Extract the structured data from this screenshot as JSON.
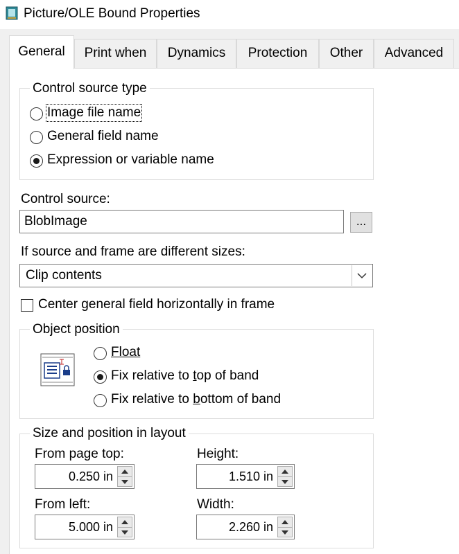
{
  "window": {
    "title": "Picture/OLE Bound Properties"
  },
  "tabs": [
    {
      "label": "General"
    },
    {
      "label": "Print when"
    },
    {
      "label": "Dynamics"
    },
    {
      "label": "Protection"
    },
    {
      "label": "Other"
    },
    {
      "label": "Advanced"
    }
  ],
  "active_tab": "General",
  "control_source_type": {
    "title": "Control source type",
    "options": [
      {
        "label": "Image file name",
        "selected": false
      },
      {
        "label": "General field name",
        "selected": false
      },
      {
        "label": "Expression or variable name",
        "selected": true
      }
    ]
  },
  "control_source": {
    "label": "Control source:",
    "value": "BlobImage",
    "browse_label": "..."
  },
  "size_mismatch": {
    "label": "If source and frame are different sizes:",
    "selected": "Clip contents"
  },
  "center_checkbox": {
    "label": "Center general field horizontally in frame",
    "checked": false
  },
  "object_position": {
    "title": "Object position",
    "float_label": "Float",
    "fix_top_pre": "Fix relative to ",
    "fix_top_ul": "t",
    "fix_top_post": "op of band",
    "fix_bottom_pre": "Fix relative to ",
    "fix_bottom_ul": "b",
    "fix_bottom_post": "ottom of band",
    "selected": "Fix relative to top of band"
  },
  "size_position": {
    "title": "Size and position in layout",
    "from_page_top": {
      "label": "From page top:",
      "value": "0.250 in"
    },
    "height": {
      "label": "Height:",
      "value": "1.510 in"
    },
    "from_left": {
      "label": "From left:",
      "value": "5.000 in"
    },
    "width": {
      "label": "Width:",
      "value": "2.260 in"
    }
  }
}
